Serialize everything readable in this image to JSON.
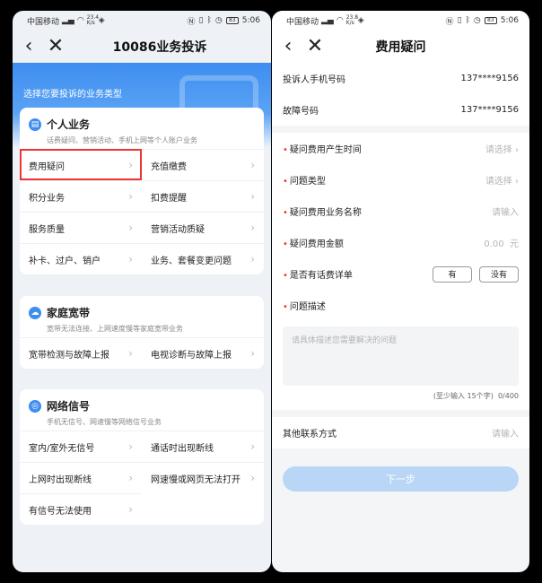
{
  "status": {
    "carrier": "中国移动",
    "speed": "23.4 K/s",
    "speed_right": "23.8 K/s",
    "battery": "83",
    "time": "5:06"
  },
  "left": {
    "title": "10086业务投诉",
    "banner_tip": "选择您要投诉的业务类型",
    "sections": [
      {
        "title": "个人业务",
        "desc": "话费疑问、营销活动、手机上网等个人账户业务",
        "items": [
          "费用疑问",
          "充值缴费",
          "积分业务",
          "扣费提醒",
          "服务质量",
          "营销活动质疑",
          "补卡、过户、销户",
          "业务、套餐变更问题"
        ]
      },
      {
        "title": "家庭宽带",
        "desc": "宽带无法连接、上网速度慢等家庭宽带业务",
        "items": [
          "宽带检测与故障上报",
          "电视诊断与故障上报"
        ]
      },
      {
        "title": "网络信号",
        "desc": "手机无信号、网速慢等网络信号业务",
        "items": [
          "室内/室外无信号",
          "通话时出现断线",
          "上网时出现断线",
          "网速慢或网页无法打开",
          "有信号无法使用"
        ]
      }
    ]
  },
  "right": {
    "title": "费用疑问",
    "phone_label": "投诉人手机号码",
    "phone_value": "137****9156",
    "fault_label": "故障号码",
    "fault_value": "137****9156",
    "time_label": "疑问费用产生时间",
    "type_label": "问题类型",
    "service_label": "疑问费用业务名称",
    "amount_label": "疑问费用金额",
    "bill_label": "是否有话费详单",
    "desc_label": "问题描述",
    "select_ph": "请选择",
    "input_ph": "请输入",
    "amount_ph": "0.00",
    "amount_unit": "元",
    "yes": "有",
    "no": "没有",
    "desc_ph": "请具体描述您需要解决的问题",
    "counter_hint": "(至少输入 15个字)",
    "counter": "0/400",
    "other_label": "其他联系方式",
    "next": "下一步"
  }
}
